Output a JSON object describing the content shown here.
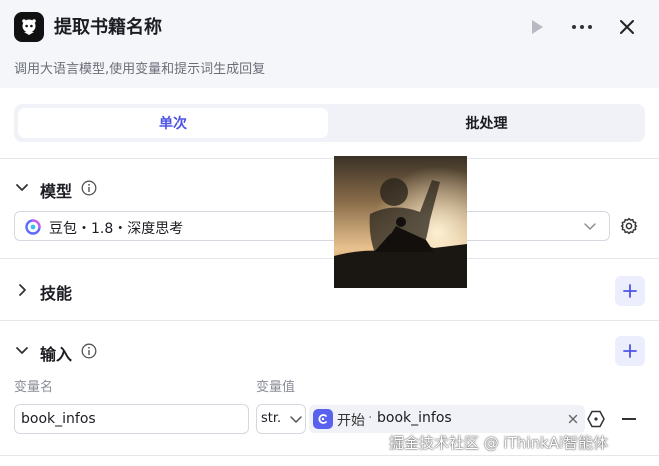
{
  "header": {
    "title": "提取书籍名称",
    "subtitle": "调用大语言模型,使用变量和提示词生成回复",
    "app_icon": "robot-avatar-icon",
    "run_icon": "play-icon",
    "more_icon": "more-dots-icon",
    "close_icon": "close-icon"
  },
  "tabs": [
    {
      "label": "单次",
      "active": true
    },
    {
      "label": "批处理",
      "active": false
    }
  ],
  "model_section": {
    "title": "模型",
    "selected_model": "豆包・1.8・深度思考",
    "settings_icon": "gear-icon"
  },
  "skills_section": {
    "title": "技能"
  },
  "input_section": {
    "title": "输入",
    "col_name": "变量名",
    "col_value": "变量值",
    "rows": [
      {
        "name": "book_infos",
        "type": "str.",
        "ref_node": "开始",
        "ref_separator": "·",
        "ref_var": "book_infos"
      }
    ]
  },
  "watermark": "掘金技术社区 @ iThinkAi智能体",
  "colors": {
    "accent": "#4c54e6",
    "accent_bg": "#eceefe",
    "header_bg": "#f5f6fa",
    "border": "#d6d8e0"
  }
}
